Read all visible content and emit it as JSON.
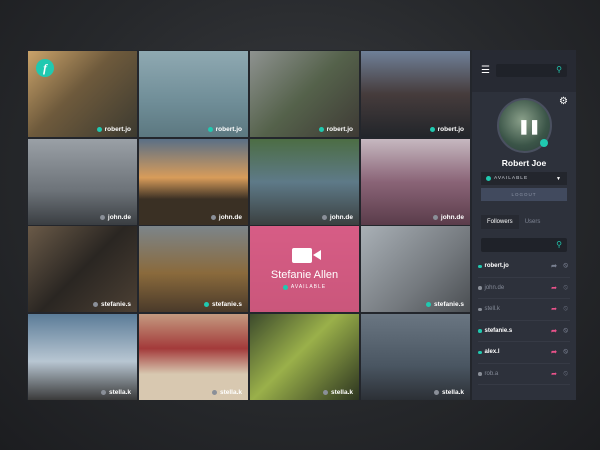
{
  "tiles": [
    {
      "user": "robert.jo",
      "status": "teal",
      "bg": "linear-gradient(135deg,#caa36a,#6e5a3c 45%,#3c3a30)"
    },
    {
      "user": "robert.jo",
      "status": "teal",
      "bg": "linear-gradient(180deg,#8fa9b2,#6f8d97 60%,#5c7880)"
    },
    {
      "user": "robert.jo",
      "status": "teal",
      "bg": "linear-gradient(135deg,#8e9290,#55624b 50%,#3e3a35)"
    },
    {
      "user": "robert.jo",
      "status": "teal",
      "bg": "linear-gradient(180deg,#6f8098,#463c3c 50%,#22252a)"
    },
    {
      "user": "john.de",
      "status": "gray",
      "bg": "linear-gradient(180deg,#9aa0a6,#6d7379 60%,#3a3e42)"
    },
    {
      "user": "john.de",
      "status": "gray",
      "bg": "linear-gradient(180deg,#5a6f86,#d89c5a 45%,#3a3024 70%)"
    },
    {
      "user": "john.de",
      "status": "gray",
      "bg": "linear-gradient(180deg,#4c6d44,#5e7a88 50%,#3b4040)"
    },
    {
      "user": "john.de",
      "status": "gray",
      "bg": "linear-gradient(180deg,#c6b8c0,#8a6477 50%,#5a3c4a)"
    },
    {
      "user": "stefanie.s",
      "status": "gray",
      "bg": "linear-gradient(135deg,#6a5a48,#2a2622 50%,#4c4034)"
    },
    {
      "user": "stefanie.s",
      "status": "teal",
      "bg": "linear-gradient(180deg,#7c858a,#8a6a3c 55%,#4a3a2a)"
    },
    {
      "user": "",
      "status": "",
      "bg": "linear-gradient(180deg,#a38c70,#6a7042)"
    },
    {
      "user": "stefanie.s",
      "status": "teal",
      "bg": "linear-gradient(135deg,#a9b0b6,#74797e 60%,#4a4e52)"
    },
    {
      "user": "stella.k",
      "status": "gray",
      "bg": "linear-gradient(180deg,#5b7c98,#b8c6d2 55%,#3a3a3a)"
    },
    {
      "user": "stella.k",
      "status": "gray",
      "bg": "linear-gradient(180deg,#c49a80,#a33a3a 40%,#d8c8b0 70%)"
    },
    {
      "user": "stella.k",
      "status": "gray",
      "bg": "linear-gradient(135deg,#3c4a2c,#9ab04a 45%,#2c3420)"
    },
    {
      "user": "stella.k",
      "status": "gray",
      "bg": "linear-gradient(180deg,#6a7682,#4a5662 60%,#2c3036)"
    }
  ],
  "highlight": {
    "name": "Stefanie Allen",
    "status": "AVAILABLE"
  },
  "logo": "f",
  "sidebar": {
    "user": "Robert Joe",
    "status": "AVAILABLE",
    "logout": "LOGOUT",
    "tabs": [
      "Followers",
      "Users"
    ],
    "followers": [
      {
        "name": "robert.jo",
        "online": true,
        "share_color": "#7a8192"
      },
      {
        "name": "john.de",
        "online": false,
        "share_color": "#e9528a"
      },
      {
        "name": "stell.k",
        "online": false,
        "share_color": "#e9528a"
      },
      {
        "name": "stefanie.s",
        "online": true,
        "share_color": "#e9528a"
      },
      {
        "name": "alex.l",
        "online": true,
        "share_color": "#e9528a"
      },
      {
        "name": "rob.a",
        "online": false,
        "share_color": "#e9528a"
      }
    ]
  }
}
